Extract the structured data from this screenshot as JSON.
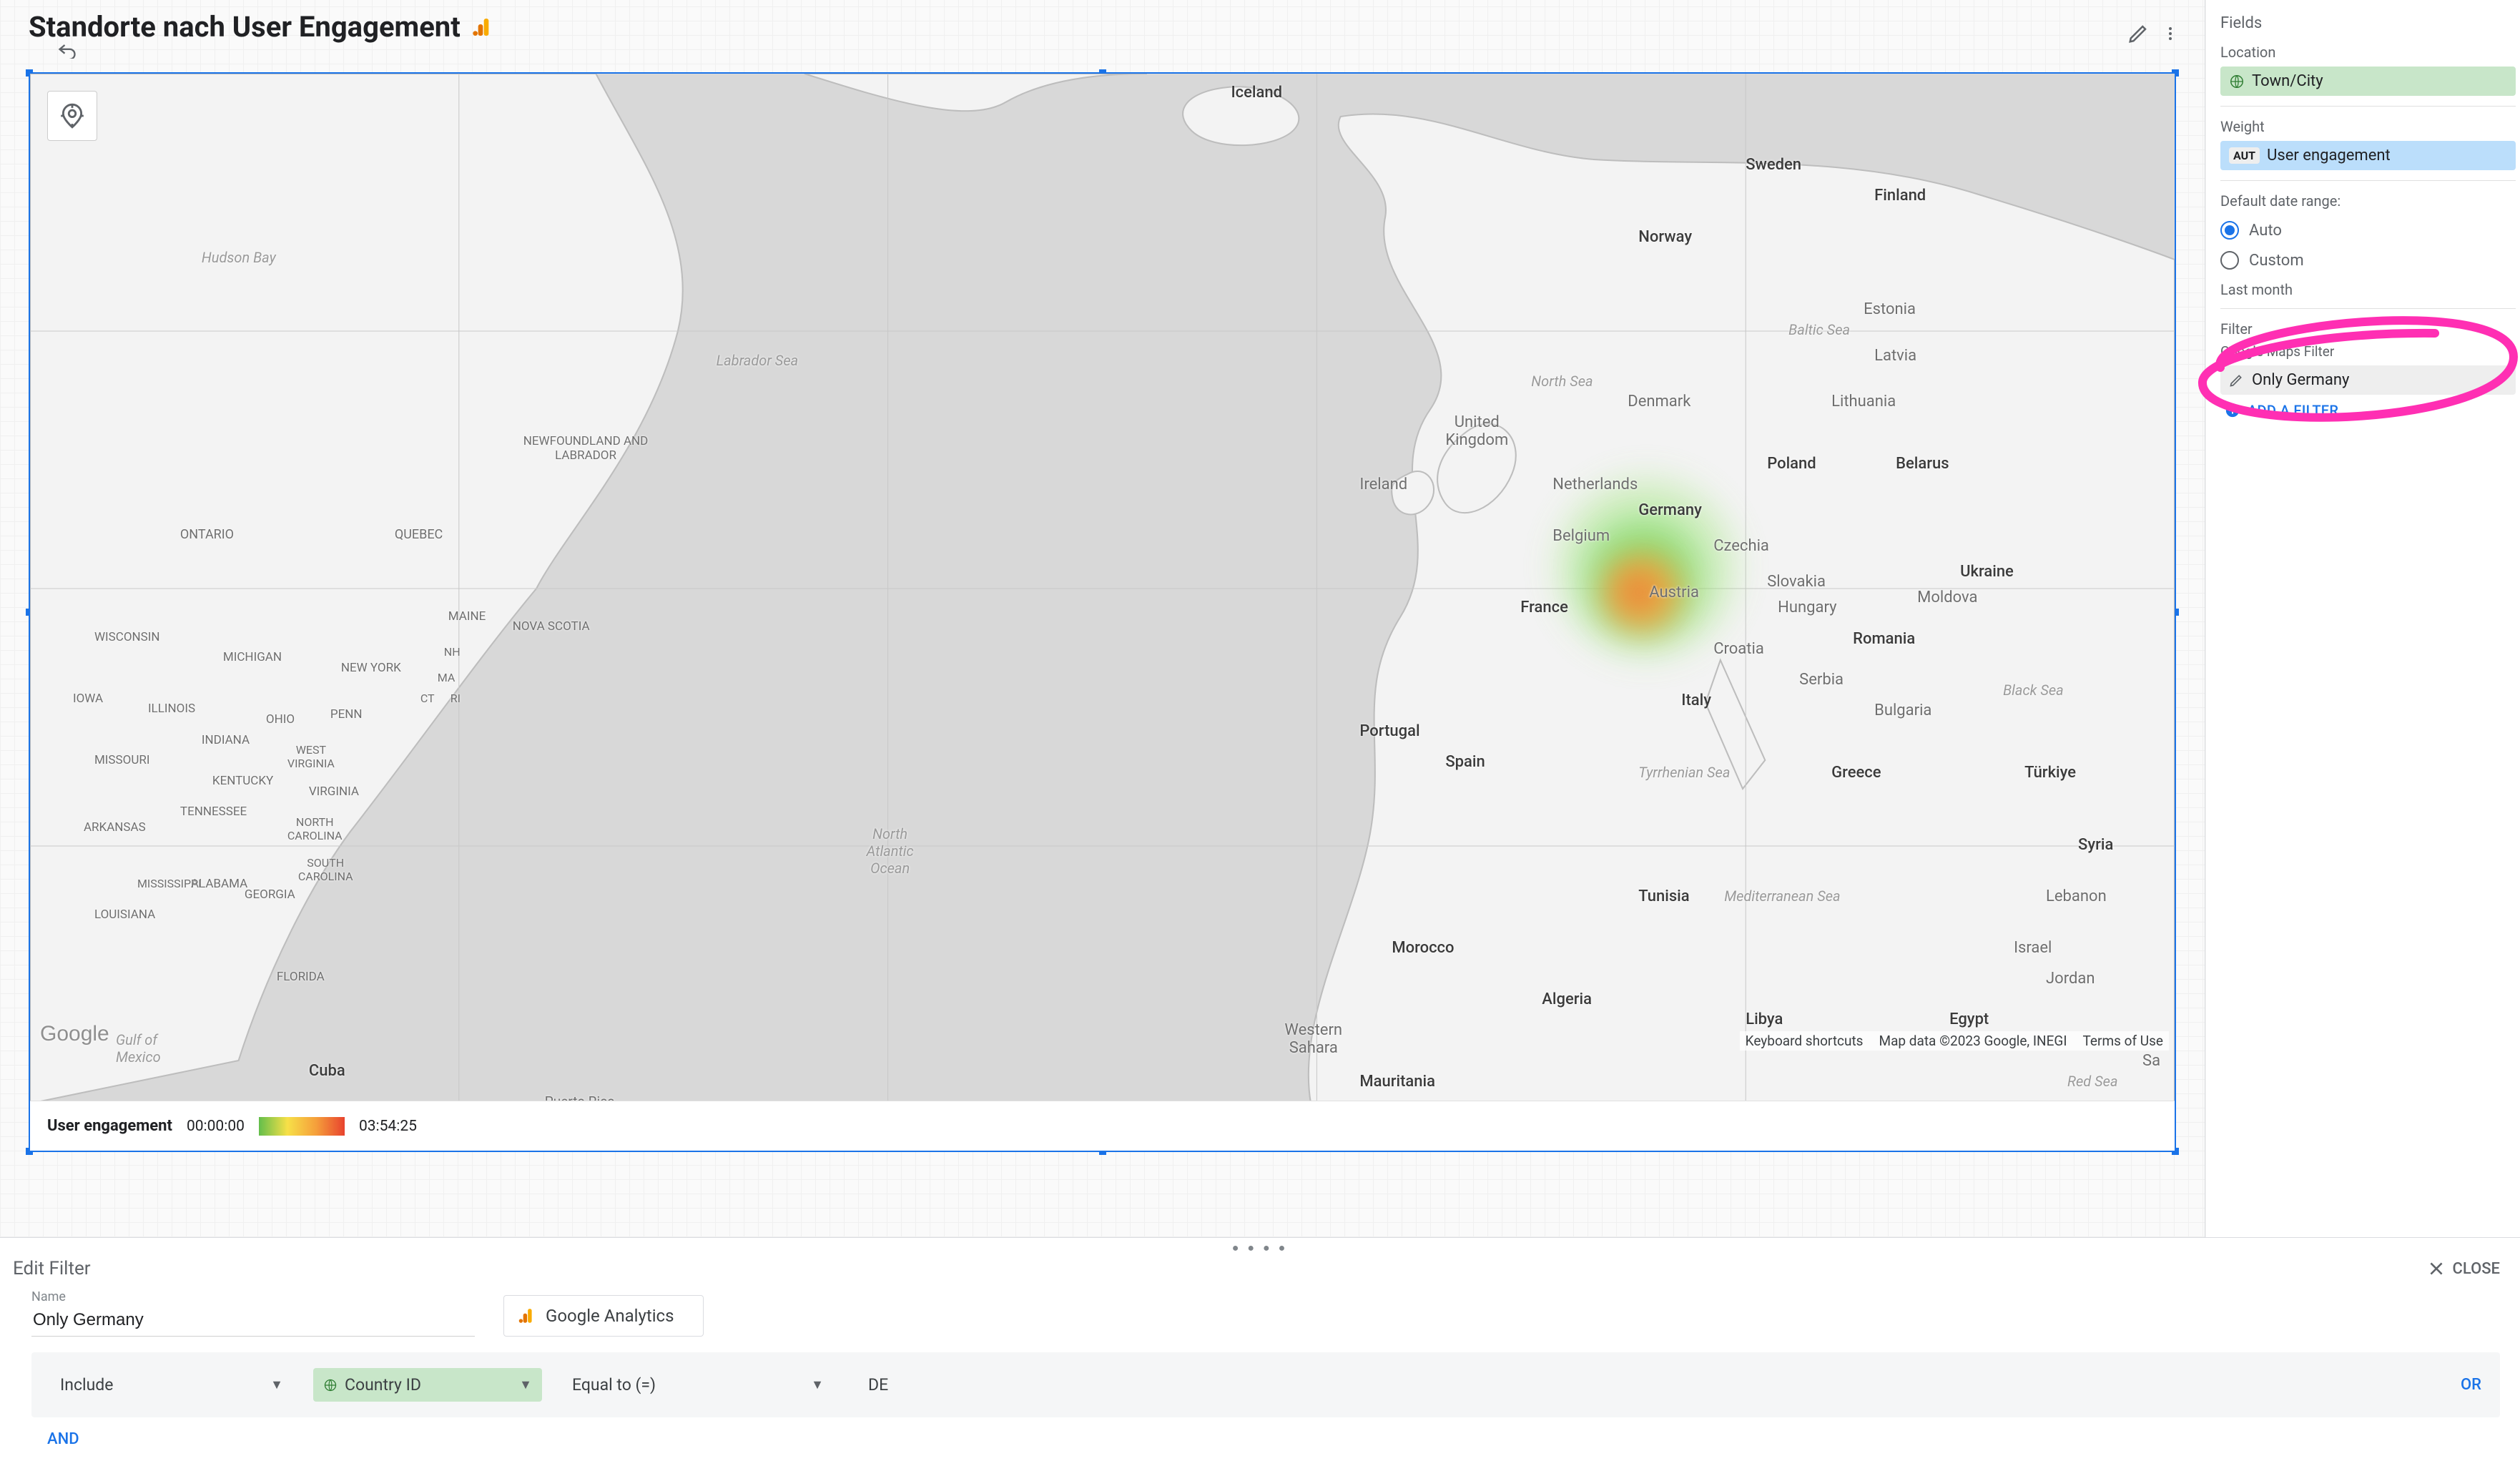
{
  "header": {
    "title": "Standorte nach User Engagement"
  },
  "map": {
    "legend_label": "User engagement",
    "legend_min": "00:00:00",
    "legend_max": "03:54:25",
    "attrib_shortcuts": "Keyboard shortcuts",
    "attrib_data": "Map data ©2023 Google, INEGI",
    "attrib_terms": "Terms of Use",
    "google_logo": "Google",
    "labels": {
      "iceland": "Iceland",
      "sweden": "Sweden",
      "norway": "Norway",
      "finland": "Finland",
      "estonia": "Estonia",
      "latvia": "Latvia",
      "lithuania": "Lithuania",
      "denmark": "Denmark",
      "uk": "United\nKingdom",
      "ireland": "Ireland",
      "netherlands": "Netherlands",
      "belgium": "Belgium",
      "germany": "Germany",
      "poland": "Poland",
      "belarus": "Belarus",
      "ukraine": "Ukraine",
      "czechia": "Czechia",
      "slovakia": "Slovakia",
      "austria": "Austria",
      "hungary": "Hungary",
      "france": "France",
      "moldova": "Moldova",
      "romania": "Romania",
      "croatia": "Croatia",
      "serbia": "Serbia",
      "bulgaria": "Bulgaria",
      "italy": "Italy",
      "portugal": "Portugal",
      "spain": "Spain",
      "greece": "Greece",
      "turkey": "Türkiye",
      "syria": "Syria",
      "lebanon": "Lebanon",
      "israel": "Israel",
      "jordan": "Jordan",
      "tunisia": "Tunisia",
      "algeria": "Algeria",
      "morocco": "Morocco",
      "libya": "Libya",
      "egypt": "Egypt",
      "mauritania": "Mauritania",
      "wsahara": "Western\nSahara",
      "hudson": "Hudson Bay",
      "labrador": "Labrador Sea",
      "natlantic": "North\nAtlantic\nOcean",
      "gulfmex": "Gulf of\nMexico",
      "northsea": "North Sea",
      "balticsea": "Baltic Sea",
      "tyrrhenian": "Tyrrhenian Sea",
      "medsea": "Mediterranean Sea",
      "blacksea": "Black Sea",
      "redsea": "Red Sea",
      "ontario": "ONTARIO",
      "quebec": "QUEBEC",
      "newfoundland": "NEWFOUNDLAND AND\nLABRADOR",
      "novascotia": "NOVA SCOTIA",
      "maine": "MAINE",
      "nh": "NH",
      "ma": "MA",
      "ct": "CT",
      "ri": "RI",
      "newyork": "NEW YORK",
      "penn": "PENN",
      "ohio": "OHIO",
      "indiana": "INDIANA",
      "michigan": "MICHIGAN",
      "illinois": "ILLINOIS",
      "wisconsin": "WISCONSIN",
      "iowa": "IOWA",
      "missouri": "MISSOURI",
      "arkansas": "ARKANSAS",
      "kentucky": "KENTUCKY",
      "tennessee": "TENNESSEE",
      "wvirginia": "WEST\nVIRGINIA",
      "virginia": "VIRGINIA",
      "ncarolina": "NORTH\nCAROLINA",
      "scarolina": "SOUTH\nCAROLINA",
      "georgia": "GEORGIA",
      "alabama": "ALABAMA",
      "mississippi": "MISSISSIPPI",
      "louisiana": "LOUISIANA",
      "florida": "FLORIDA",
      "cuba": "Cuba",
      "puertorico": "Puerto Rico",
      "sa": "Sa"
    }
  },
  "side": {
    "fields_title": "Fields",
    "location_label": "Location",
    "location_value": "Town/City",
    "weight_label": "Weight",
    "weight_badge": "AUT",
    "weight_value": "User engagement",
    "daterange_label": "Default date range:",
    "auto": "Auto",
    "custom": "Custom",
    "lastmonth": "Last month",
    "filter_title": "Filter",
    "gmaps_filter": "Google Maps Filter",
    "filter_name": "Only Germany",
    "add_filter": "ADD A FILTER"
  },
  "editor": {
    "title": "Edit Filter",
    "close": "CLOSE",
    "name_label": "Name",
    "name_value": "Only Germany",
    "source": "Google Analytics",
    "include": "Include",
    "field": "Country ID",
    "op": "Equal to (=)",
    "value": "DE",
    "or": "OR",
    "and": "AND"
  }
}
